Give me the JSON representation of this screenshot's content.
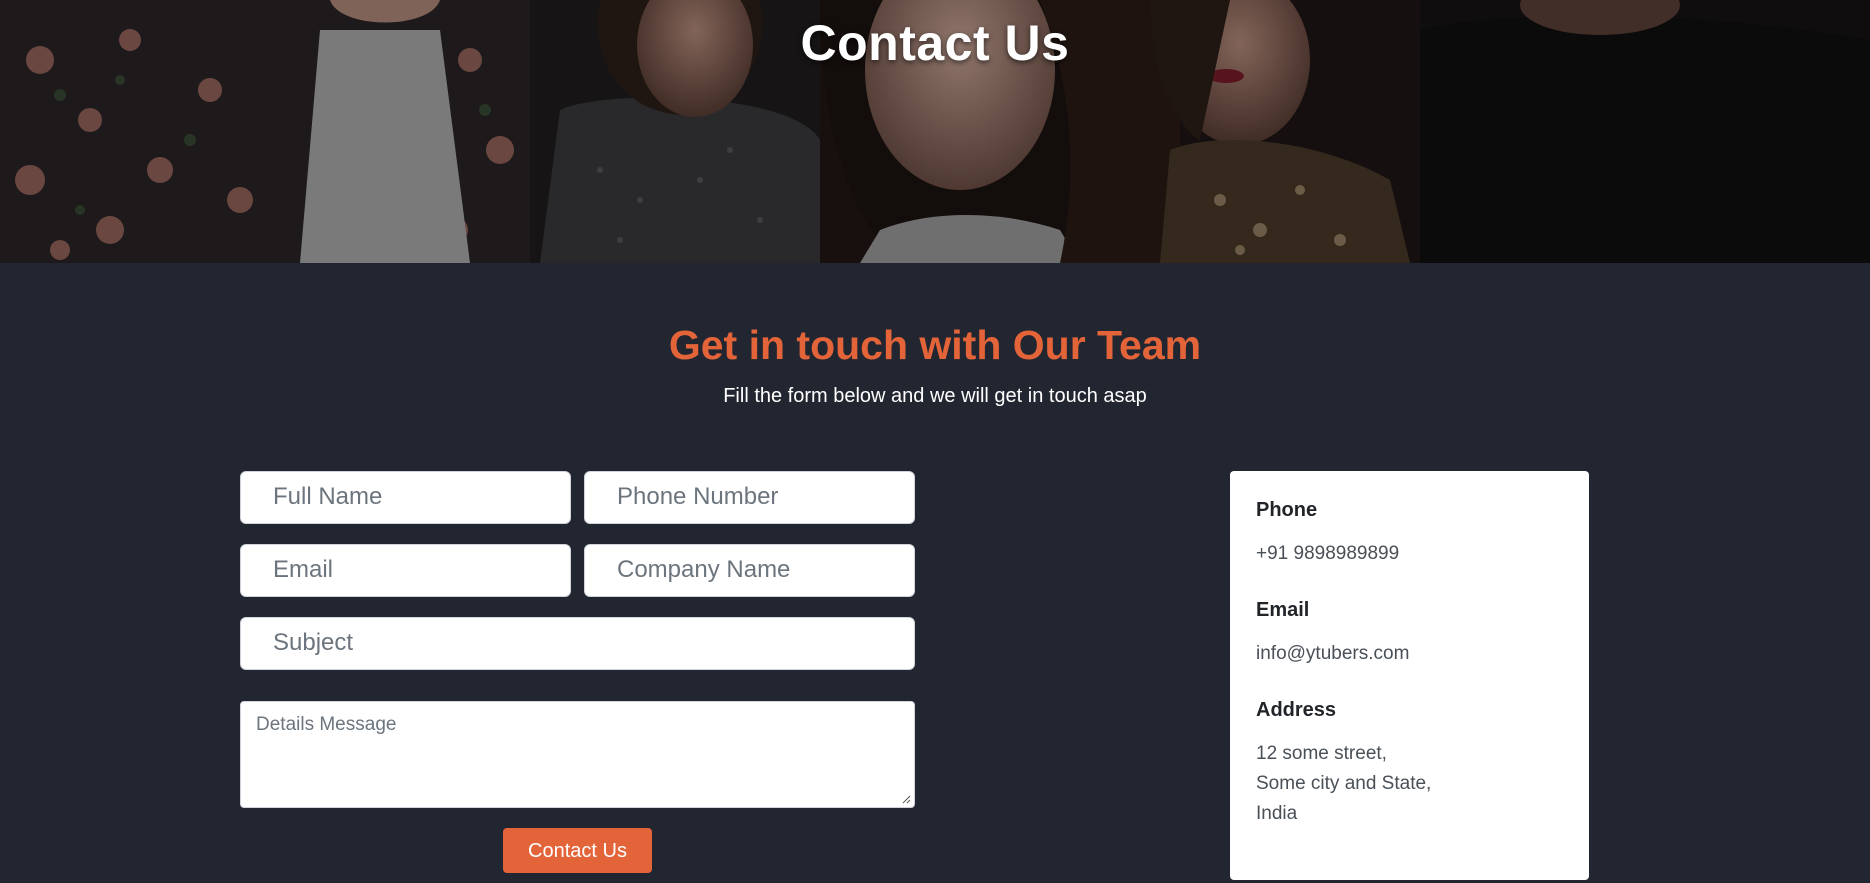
{
  "hero": {
    "title": "Contact Us"
  },
  "section": {
    "title": "Get in touch with Our Team",
    "subtitle": "Fill the form below and we will get in touch asap"
  },
  "form": {
    "full_name_placeholder": "Full Name",
    "phone_placeholder": "Phone Number",
    "email_placeholder": "Email",
    "company_placeholder": "Company Name",
    "subject_placeholder": "Subject",
    "message_placeholder": "Details Message",
    "submit_label": "Contact Us"
  },
  "info": {
    "phone_label": "Phone",
    "phone_value": "+91 9898989899",
    "email_label": "Email",
    "email_value": "info@ytubers.com",
    "address_label": "Address",
    "address_lines": [
      "12 some street,",
      "Some city and State,",
      "India"
    ]
  },
  "colors": {
    "accent": "#e4643a",
    "background": "#222630",
    "card": "#ffffff"
  }
}
